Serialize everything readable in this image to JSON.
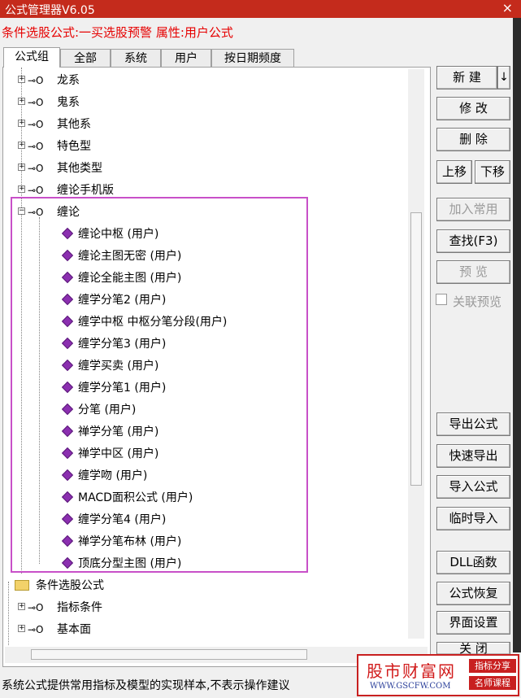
{
  "window": {
    "title": "公式管理器V6.05",
    "close": "×"
  },
  "subtitle": "条件选股公式:一买选股预警  属性:用户公式",
  "tabs": [
    "公式组",
    "全部",
    "系统",
    "用户",
    "按日期频度"
  ],
  "tree": {
    "top_groups": [
      "龙系",
      "鬼系",
      "其他系",
      "特色型",
      "其他类型",
      "缠论手机版"
    ],
    "open_group": "缠论",
    "children": [
      "缠论中枢 (用户)",
      "缠论主图无密 (用户)",
      "缠论全能主图 (用户)",
      "缠学分笔2 (用户)",
      "缠学中枢  中枢分笔分段(用户)",
      "缠学分笔3 (用户)",
      "缠学买卖  (用户)",
      "缠学分笔1 (用户)",
      "分笔  (用户)",
      "禅学分笔  (用户)",
      "禅学中区  (用户)",
      "缠学吻  (用户)",
      "MACD面积公式  (用户)",
      "缠学分笔4 (用户)",
      "禅学分笔布林  (用户)",
      "顶底分型主图 (用户)"
    ],
    "root_folder": "条件选股公式",
    "root_children": [
      "指标条件",
      "基本面"
    ]
  },
  "buttons": {
    "new": "新 建",
    "new_arrow": "↓",
    "modify": "修 改",
    "delete": "删 除",
    "move_up": "上移",
    "move_down": "下移",
    "add_common": "加入常用",
    "find": "查找(F3)",
    "preview": "预 览",
    "link_preview": "关联预览",
    "export": "导出公式",
    "quick_export": "快速导出",
    "import": "导入公式",
    "temp_import": "临时导入",
    "dll": "DLL函数",
    "restore": "公式恢复",
    "ui_settings": "界面设置",
    "close": "关 闭"
  },
  "status": "系统公式提供常用指标及模型的实现样本,不表示操作建议",
  "watermark": {
    "name": "股市财富网",
    "url": "WWW.GSCFW.COM",
    "tag1": "指标分享",
    "tag2": "名师课程"
  }
}
